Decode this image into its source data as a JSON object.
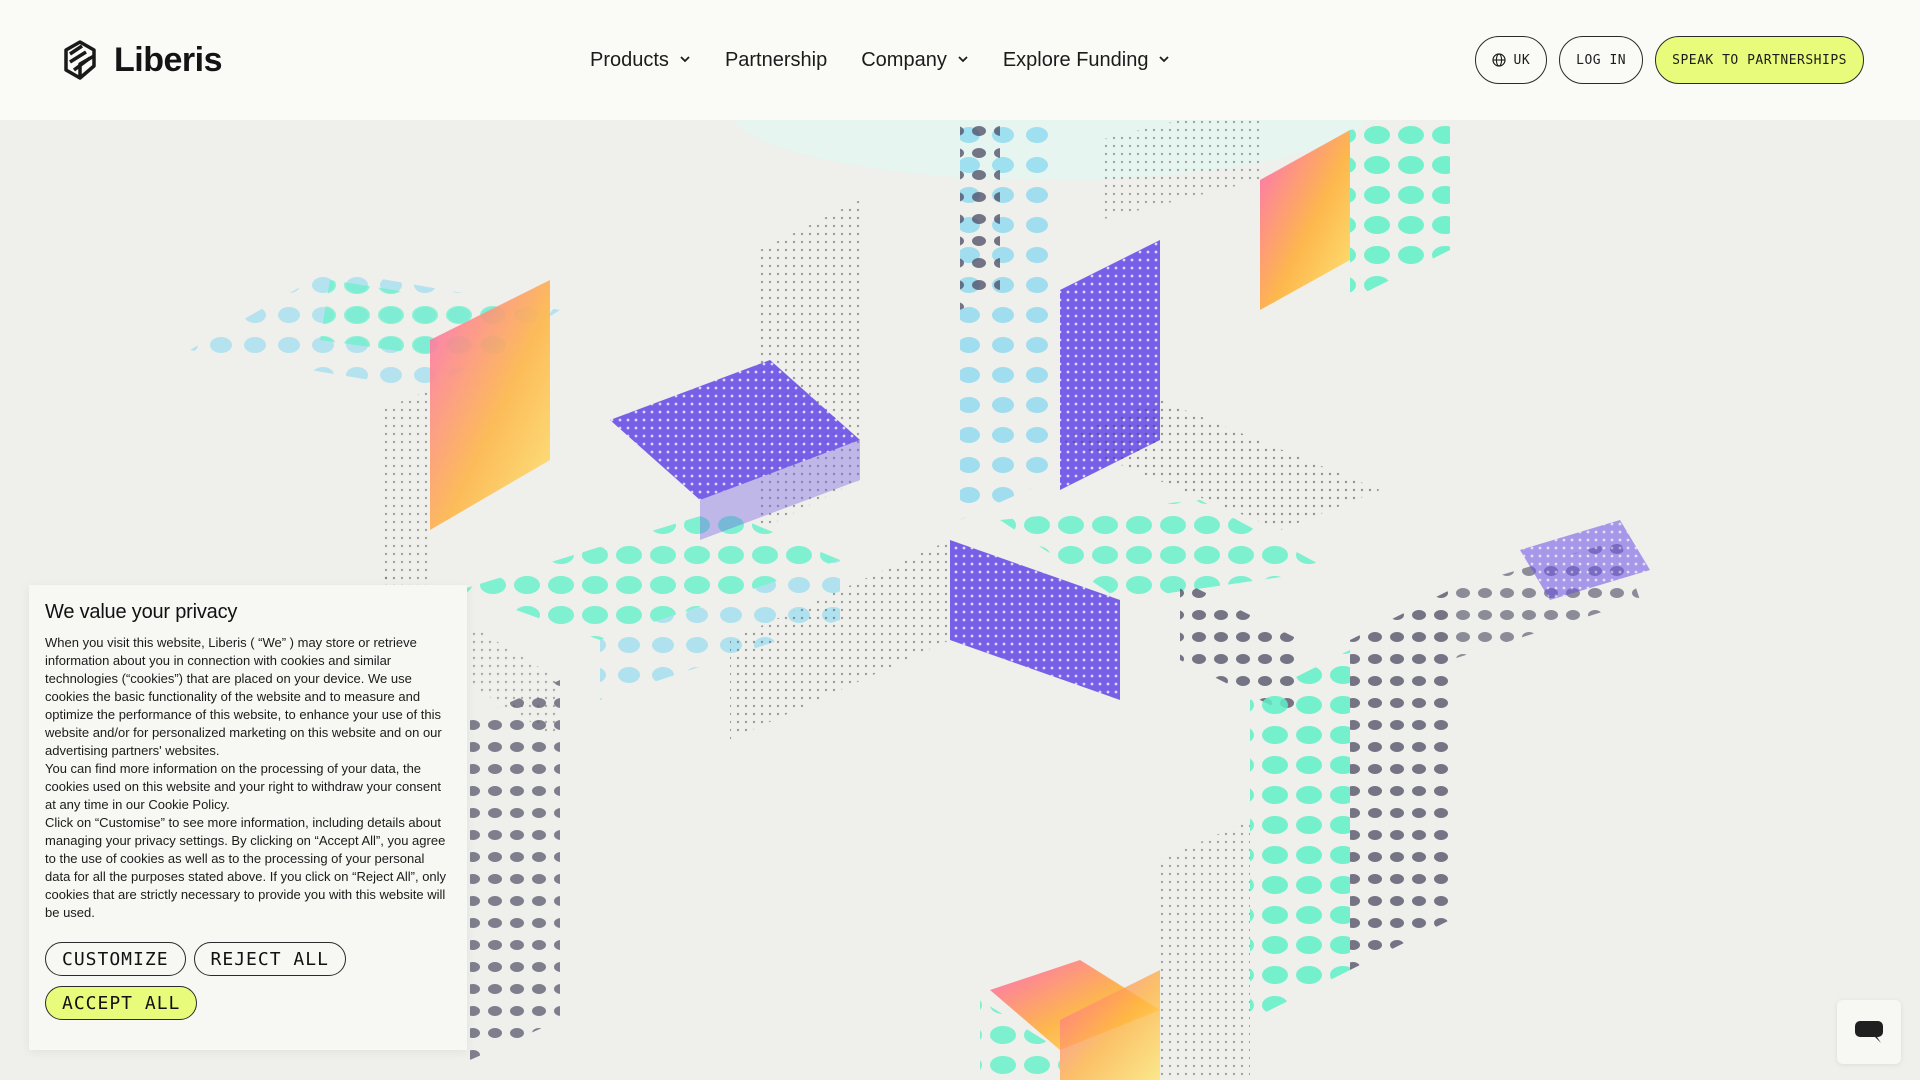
{
  "brand": {
    "name": "Liberis",
    "logo_icon": "liberis-logo-icon"
  },
  "nav": {
    "items": [
      {
        "label": "Products",
        "has_dropdown": true
      },
      {
        "label": "Partnership",
        "has_dropdown": false
      },
      {
        "label": "Company",
        "has_dropdown": true
      },
      {
        "label": "Explore Funding",
        "has_dropdown": true
      }
    ]
  },
  "header_actions": {
    "region_label": "UK",
    "region_icon": "globe-icon",
    "login_label": "LOG IN",
    "cta_label": "SPEAK TO PARTNERSHIPS"
  },
  "cookie_banner": {
    "title": "We value your privacy",
    "paragraphs": [
      "When you visit this website, Liberis ( “We” ) may store or retrieve information about you in connection with cookies and similar technologies (“cookies”) that are placed on your device. We use cookies the basic functionality of the website and to measure and optimize the performance of this website, to enhance your use of this website and/or for personalized marketing on this website and on our advertising partners' websites.",
      "You can find more information on the processing of your data, the cookies used on this website and your right to withdraw your consent at any time in our Cookie Policy.",
      "Click on “Customise” to see more information, including details about managing your privacy settings. By clicking on “Accept All”, you agree to the use of cookies as well as to the processing of your personal data for all the purposes stated above. If you click on “Reject All”, only cookies that are strictly necessary to provide you with this website will be used."
    ],
    "buttons": {
      "customize": "CUSTOMIZE",
      "reject_all": "REJECT ALL",
      "accept_all": "ACCEPT ALL"
    }
  },
  "chat_widget": {
    "icon": "chat-bubble-icon"
  },
  "colors": {
    "accent": "#e9fb7b",
    "background": "#efefeb",
    "header_bg": "#fafaf7",
    "purple": "#6a4fe6",
    "teal": "#5ff0c8",
    "sky": "#8cd9f0",
    "slate": "#4a4a63",
    "orange": "#ff9c3b",
    "pink": "#ff5fb6"
  }
}
